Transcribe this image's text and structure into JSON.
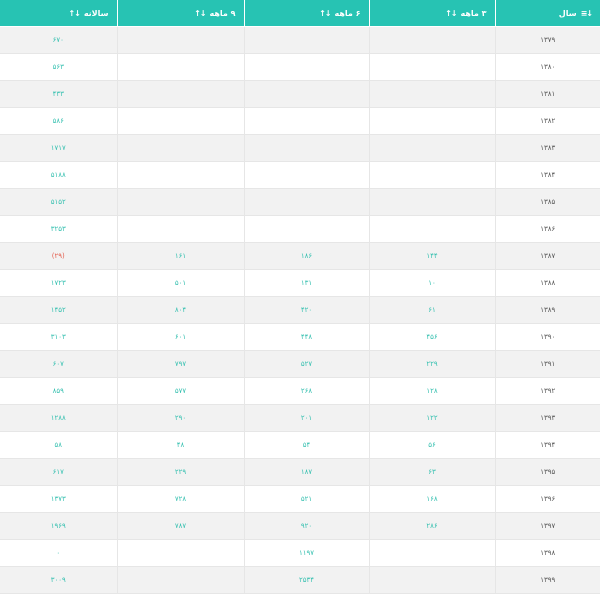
{
  "headers": {
    "annual": "ساﻻنه",
    "m9": "۹ ماهه",
    "m6": "۶ ماهه",
    "m3": "۳ ماهه",
    "year": "سال"
  },
  "rows": [
    {
      "year": "۱۳۷۹",
      "m3": "",
      "m6": "",
      "m9": "",
      "annual": "۶۷۰"
    },
    {
      "year": "۱۳۸۰",
      "m3": "",
      "m6": "",
      "m9": "",
      "annual": "۵۶۳"
    },
    {
      "year": "۱۳۸۱",
      "m3": "",
      "m6": "",
      "m9": "",
      "annual": "۴۳۳"
    },
    {
      "year": "۱۳۸۲",
      "m3": "",
      "m6": "",
      "m9": "",
      "annual": "۵۸۶"
    },
    {
      "year": "۱۳۸۳",
      "m3": "",
      "m6": "",
      "m9": "",
      "annual": "۱۷۱۷"
    },
    {
      "year": "۱۳۸۴",
      "m3": "",
      "m6": "",
      "m9": "",
      "annual": "۵۱۸۸"
    },
    {
      "year": "۱۳۸۵",
      "m3": "",
      "m6": "",
      "m9": "",
      "annual": "۵۱۵۲"
    },
    {
      "year": "۱۳۸۶",
      "m3": "",
      "m6": "",
      "m9": "",
      "annual": "۳۲۵۳"
    },
    {
      "year": "۱۳۸۷",
      "m3": "۱۴۴",
      "m6": "۱۸۶",
      "m9": "۱۶۱",
      "annual": "(۲۹)",
      "annual_negative": true
    },
    {
      "year": "۱۳۸۸",
      "m3": "۱۰",
      "m6": "۱۳۱",
      "m9": "۵۰۱",
      "annual": "۱۷۲۳"
    },
    {
      "year": "۱۳۸۹",
      "m3": "۶۱",
      "m6": "۴۲۰",
      "m9": "۸۰۴",
      "annual": "۱۴۵۲"
    },
    {
      "year": "۱۳۹۰",
      "m3": "۴۵۶",
      "m6": "۴۴۸",
      "m9": "۶۰۱",
      "annual": "۳۱۰۳"
    },
    {
      "year": "۱۳۹۱",
      "m3": "۲۲۹",
      "m6": "۵۲۷",
      "m9": "۷۹۷",
      "annual": "۶۰۷"
    },
    {
      "year": "۱۳۹۲",
      "m3": "۱۲۸",
      "m6": "۲۶۸",
      "m9": "۵۷۷",
      "annual": "۸۵۹"
    },
    {
      "year": "۱۳۹۳",
      "m3": "۱۲۲",
      "m6": "۲۰۱",
      "m9": "۲۹۰",
      "annual": "۱۲۸۸"
    },
    {
      "year": "۱۳۹۴",
      "m3": "۵۶",
      "m6": "۵۴",
      "m9": "۴۸",
      "annual": "۵۸"
    },
    {
      "year": "۱۳۹۵",
      "m3": "۶۳",
      "m6": "۱۸۷",
      "m9": "۲۲۹",
      "annual": "۶۱۷"
    },
    {
      "year": "۱۳۹۶",
      "m3": "۱۶۸",
      "m6": "۵۲۱",
      "m9": "۷۲۸",
      "annual": "۱۳۷۳"
    },
    {
      "year": "۱۳۹۷",
      "m3": "۲۸۶",
      "m6": "۹۲۰",
      "m9": "۷۸۷",
      "annual": "۱۹۶۹"
    },
    {
      "year": "۱۳۹۸",
      "m3": "",
      "m6": "۱۱۹۷",
      "m9": "",
      "annual": "۰"
    },
    {
      "year": "۱۳۹۹",
      "m3": "",
      "m6": "۲۵۳۴",
      "m9": "",
      "annual": "۳۰۰۹"
    }
  ]
}
